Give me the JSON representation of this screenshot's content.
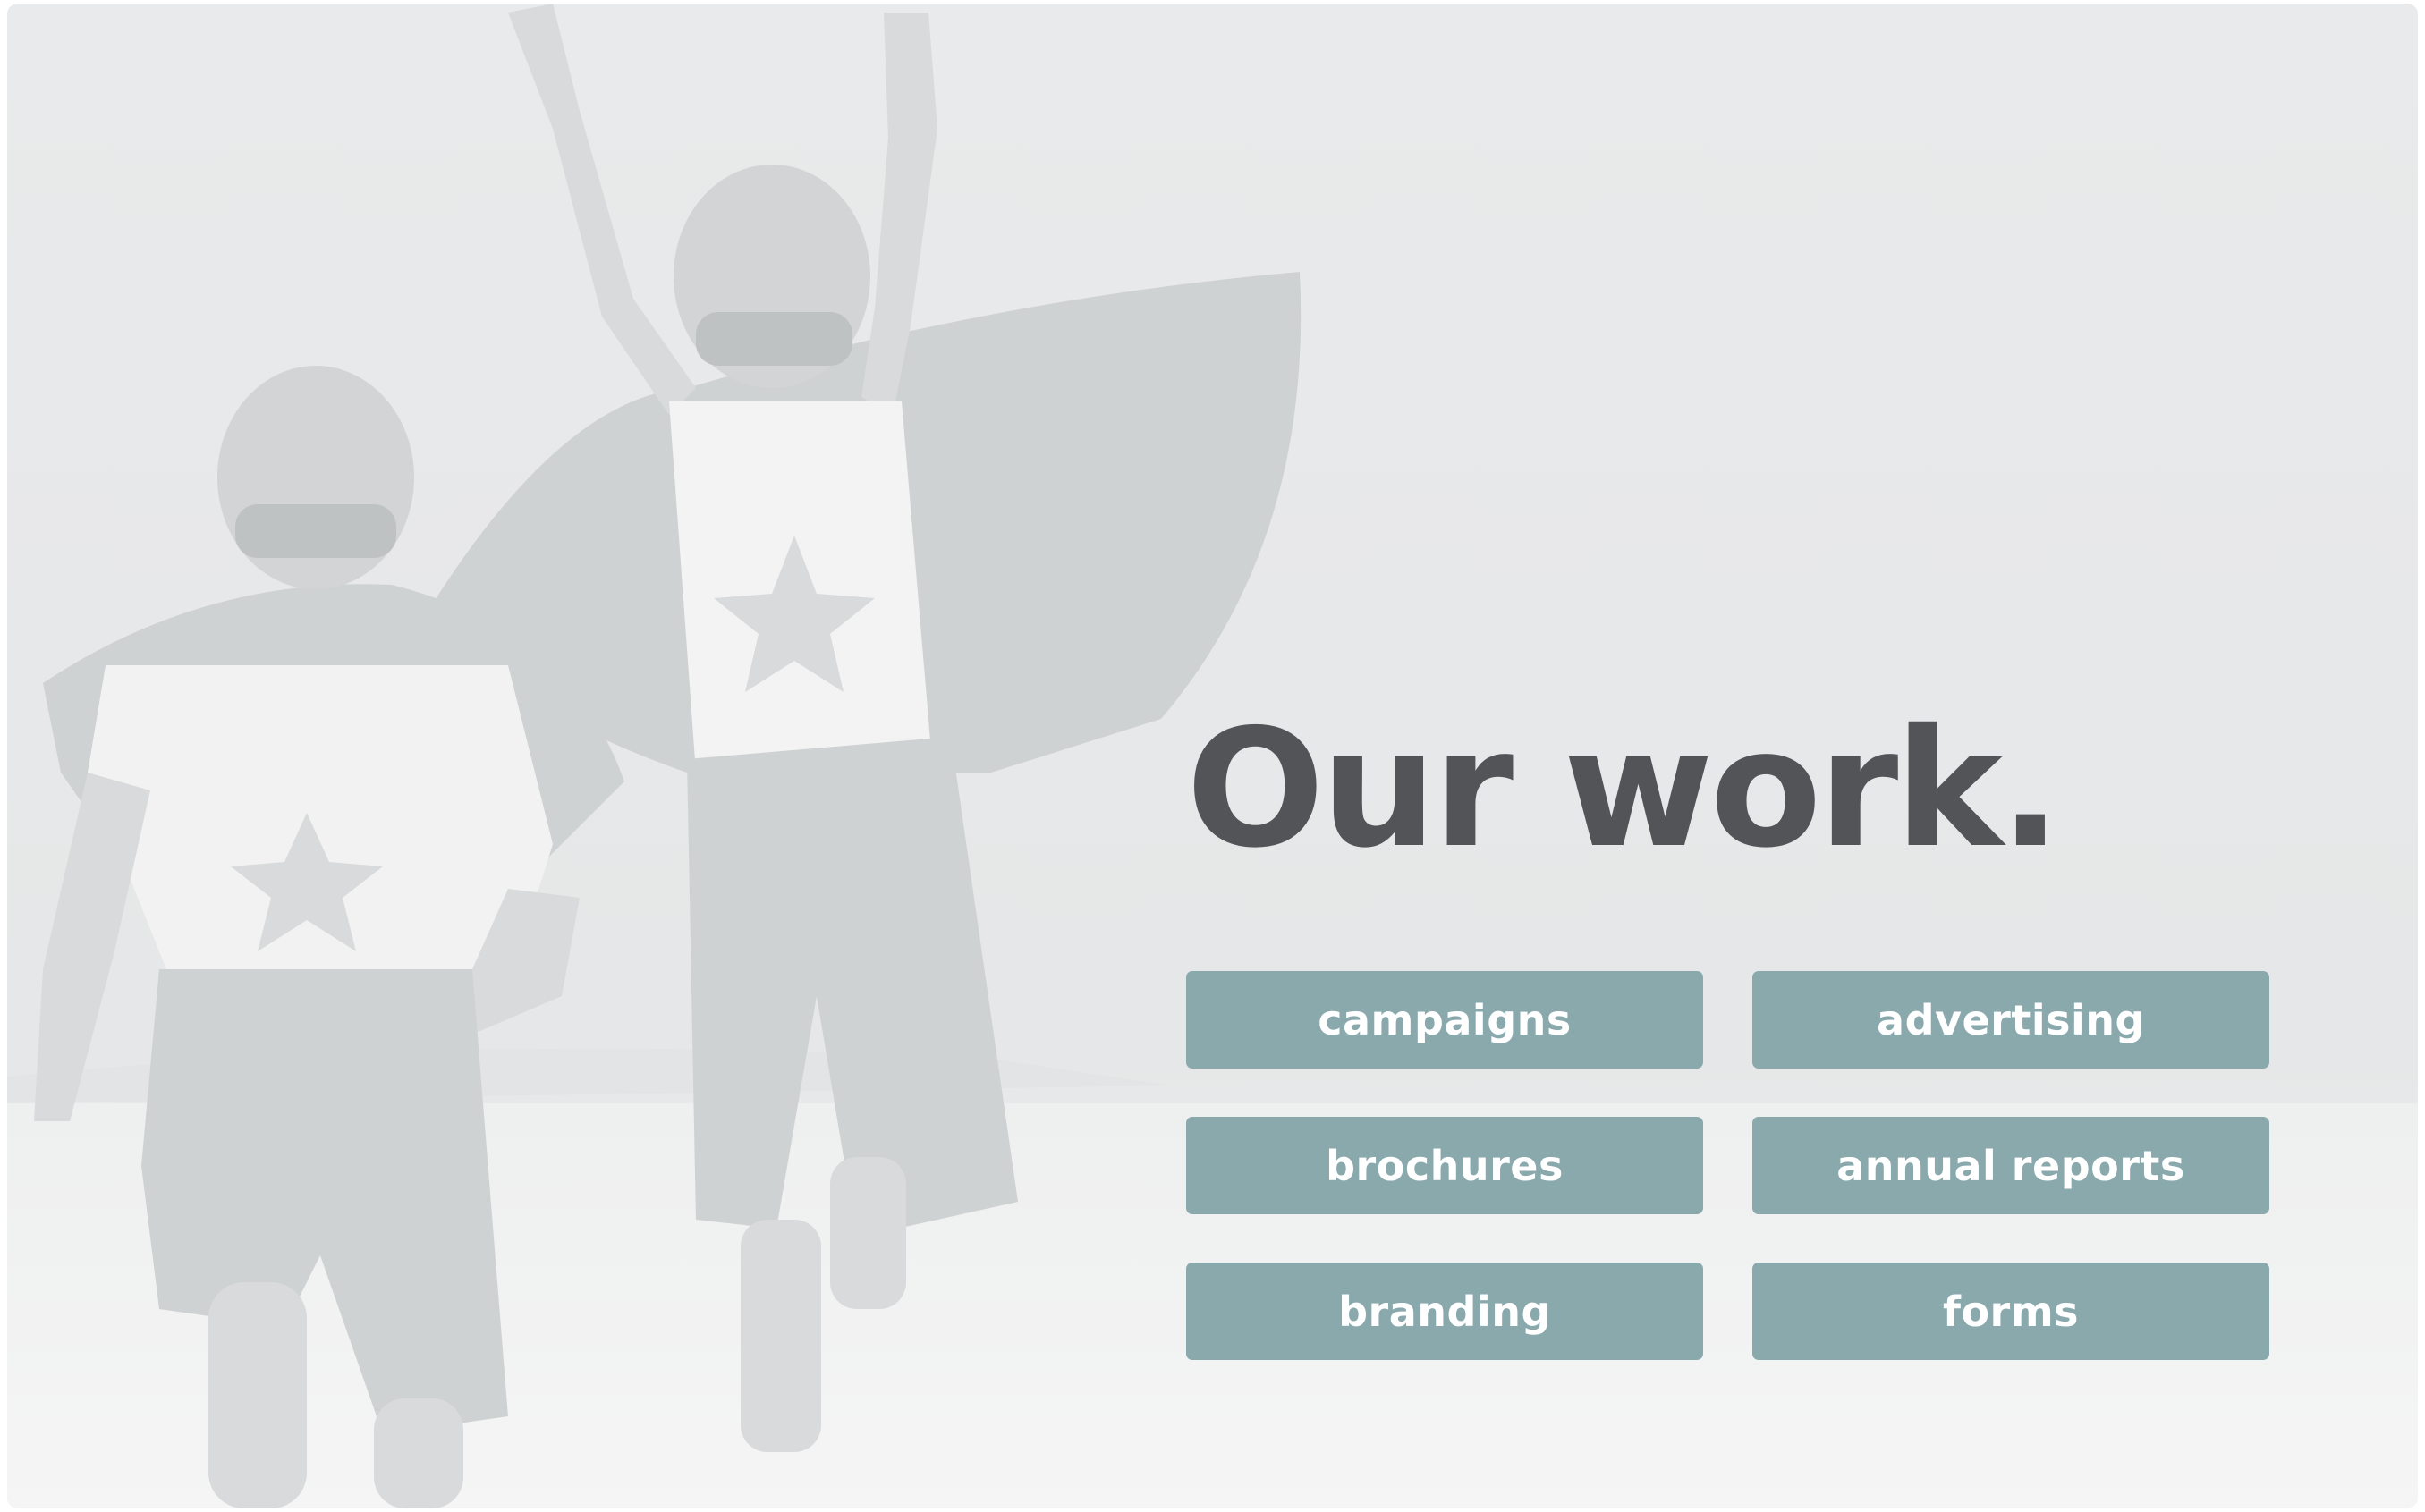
{
  "hero": {
    "heading": "Our work.",
    "image_description_icon": "superhero-kids-photo"
  },
  "colors": {
    "background": "#ebeced",
    "heading": "#525457",
    "button_background": "#8aa9ad",
    "button_text": "#ffffff"
  },
  "work_categories": [
    {
      "label": "campaigns"
    },
    {
      "label": "advertising"
    },
    {
      "label": "brochures"
    },
    {
      "label": "annual reports"
    },
    {
      "label": "branding"
    },
    {
      "label": "forms"
    }
  ]
}
